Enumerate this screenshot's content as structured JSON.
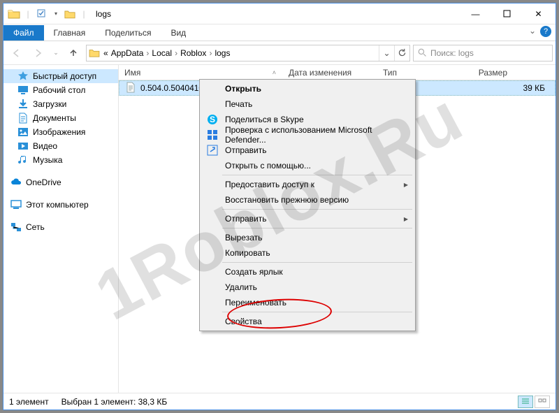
{
  "window": {
    "title": "logs",
    "qat_pin_tip": "pin",
    "min": "—",
    "max": "▢",
    "close": "✕"
  },
  "ribbon": {
    "file": "Файл",
    "tabs": [
      "Главная",
      "Поделиться",
      "Вид"
    ],
    "expand_icon": "⌄",
    "help": "?"
  },
  "nav": {
    "back": "←",
    "fwd": "→",
    "recent": "⌄",
    "up": "↑",
    "crumbs": [
      "AppData",
      "Local",
      "Roblox",
      "logs"
    ],
    "crumb_prefix": "«",
    "search_placeholder": "Поиск: logs",
    "refresh": "⟳",
    "drop": "⌄"
  },
  "sidebar": {
    "items": [
      {
        "label": "Быстрый доступ",
        "icon": "star",
        "color": "#2a90d8",
        "sel": true
      },
      {
        "label": "Рабочий стол",
        "icon": "desktop",
        "color": "#2a90d8"
      },
      {
        "label": "Загрузки",
        "icon": "download",
        "color": "#2a90d8"
      },
      {
        "label": "Документы",
        "icon": "doc",
        "color": "#2a90d8"
      },
      {
        "label": "Изображения",
        "icon": "image",
        "color": "#2a90d8"
      },
      {
        "label": "Видео",
        "icon": "video",
        "color": "#2a90d8"
      },
      {
        "label": "Музыка",
        "icon": "music",
        "color": "#2a90d8"
      }
    ],
    "group2": [
      {
        "label": "OneDrive",
        "icon": "cloud",
        "color": "#0a84d8"
      }
    ],
    "group3": [
      {
        "label": "Этот компьютер",
        "icon": "pc",
        "color": "#2a90d8"
      }
    ],
    "group4": [
      {
        "label": "Сеть",
        "icon": "net",
        "color": "#2a90d8"
      }
    ]
  },
  "columns": {
    "name": "Имя",
    "date": "Дата изменения",
    "type": "Тип",
    "size": "Размер",
    "sort": "˄"
  },
  "files": [
    {
      "name": "0.504.0.5040410_20",
      "size": "39 КБ"
    }
  ],
  "context_menu": [
    {
      "label": "Открыть",
      "bold": true
    },
    {
      "label": "Печать"
    },
    {
      "label": "Поделиться в Skype",
      "icon": "skype"
    },
    {
      "label": "Проверка с использованием Microsoft Defender...",
      "icon": "defender"
    },
    {
      "label": "Отправить",
      "icon": "share"
    },
    {
      "label": "Открыть с помощью..."
    },
    {
      "sep": true
    },
    {
      "label": "Предоставить доступ к",
      "submenu": true
    },
    {
      "label": "Восстановить прежнюю версию"
    },
    {
      "sep": true
    },
    {
      "label": "Отправить",
      "submenu": true
    },
    {
      "sep": true
    },
    {
      "label": "Вырезать"
    },
    {
      "label": "Копировать"
    },
    {
      "sep": true
    },
    {
      "label": "Создать ярлык"
    },
    {
      "label": "Удалить"
    },
    {
      "label": "Переименовать"
    },
    {
      "sep": true
    },
    {
      "label": "Свойства"
    }
  ],
  "status": {
    "count": "1 элемент",
    "selection": "Выбран 1 элемент: 38,3 КБ"
  },
  "watermark": "1Roblox.Ru"
}
